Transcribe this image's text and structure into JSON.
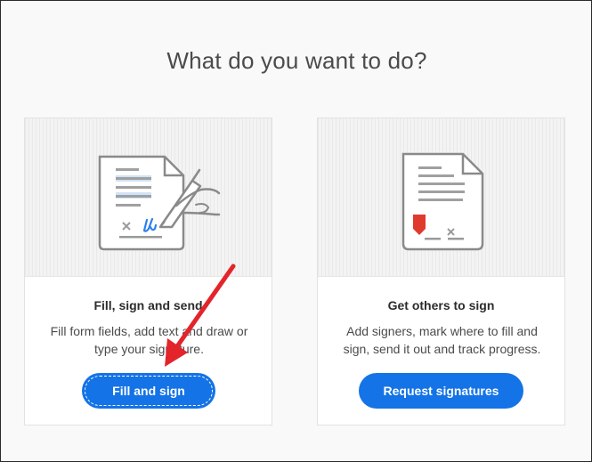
{
  "page": {
    "title": "What do you want to do?"
  },
  "options": [
    {
      "title": "Fill, sign and send",
      "description": "Fill form fields, add text and draw or type your signature.",
      "button_label": "Fill and sign",
      "icon": "fill-and-sign-document-icon"
    },
    {
      "title": "Get others to sign",
      "description": "Add signers, mark where to fill and sign, send it out and track progress.",
      "button_label": "Request signatures",
      "icon": "request-signatures-document-icon"
    }
  ],
  "colors": {
    "primary_button": "#1473e6",
    "annotation_arrow": "#e3242b",
    "signature_blue": "#2d7ff0",
    "signature_flag_red": "#e03a2c"
  }
}
